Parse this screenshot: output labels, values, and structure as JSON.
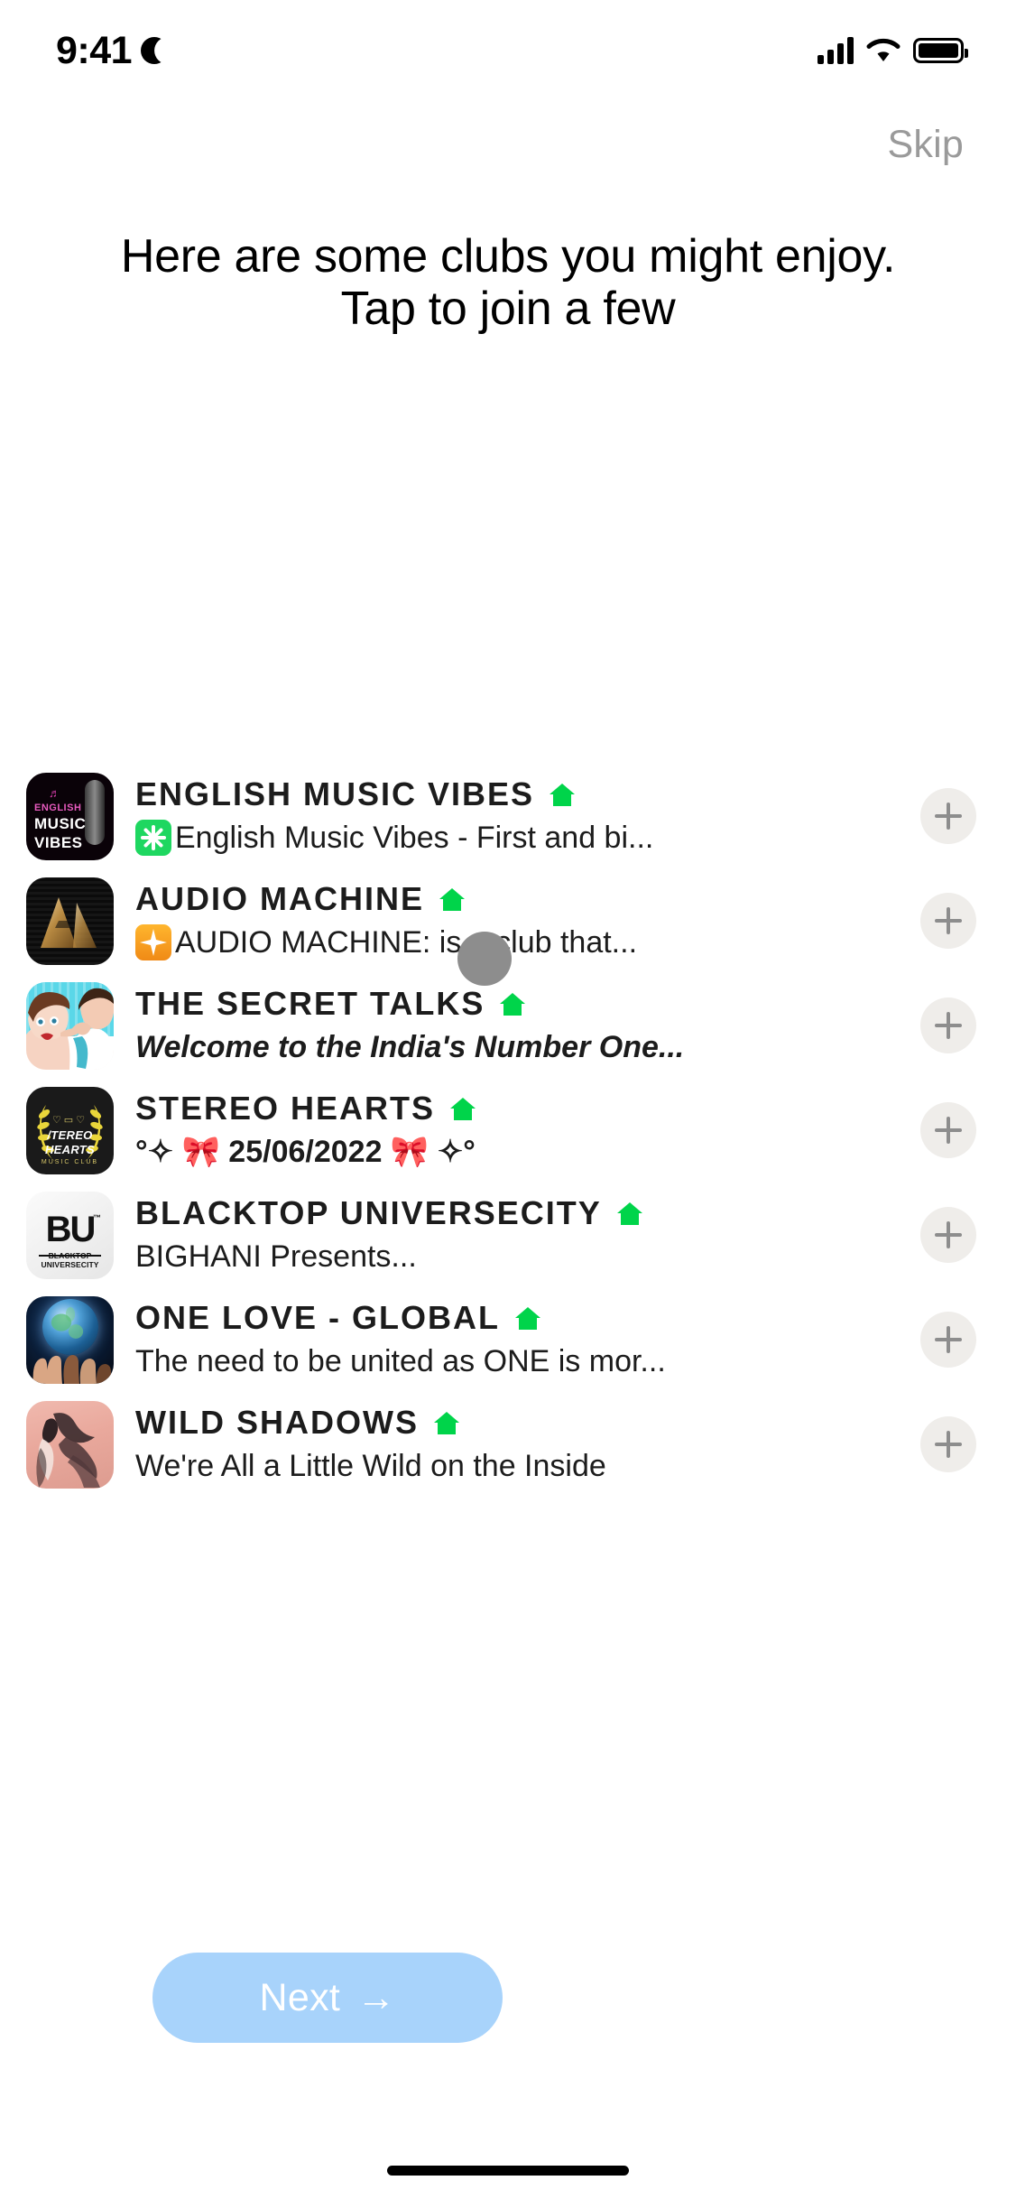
{
  "status_bar": {
    "time": "9:41",
    "dnd_icon": "crescent-moon-icon",
    "signal_icon": "cellular-signal-icon",
    "wifi_icon": "wifi-icon",
    "battery_icon": "battery-full-icon"
  },
  "header": {
    "skip_label": "Skip",
    "title": "Here are some clubs you might enjoy. Tap to join a few"
  },
  "clubs": [
    {
      "name": "ENGLISH MUSIC VIBES",
      "badge_icon": "green-house-icon",
      "sub_emoji": "green-eight-spoked-asterisk-emoji",
      "description": "English Music Vibes - First and bi...",
      "avatar_name": "english-music-vibes-avatar",
      "avatar_lines": [
        "ENGLISH",
        "MUSIC",
        "VIBES"
      ],
      "join_label": "+"
    },
    {
      "name": "AUDIO MACHINE",
      "badge_icon": "green-house-icon",
      "sub_emoji": "orange-eight-pointed-star-emoji",
      "description": "AUDIO MACHINE: is a club that...",
      "avatar_name": "audio-machine-avatar",
      "join_label": "+"
    },
    {
      "name": "THE SECRET TALKS",
      "badge_icon": "green-house-icon",
      "sub_emoji": "",
      "description": "Welcome to the India's Number One...",
      "avatar_name": "the-secret-talks-avatar",
      "join_label": "+"
    },
    {
      "name": "STEREO HEARTS",
      "badge_icon": "green-house-icon",
      "sub_emoji": "",
      "description": "°✧ 🎀 25/06/2022 🎀 ✧°",
      "avatar_name": "stereo-hearts-avatar",
      "avatar_lines": [
        "/TEREO",
        "HEARTS",
        "MUSIC CLUB"
      ],
      "join_label": "+"
    },
    {
      "name": "BLACKTOP UNIVERSECITY",
      "badge_icon": "green-house-icon",
      "sub_emoji": "",
      "description": "BIGHANI Presents...",
      "avatar_name": "blacktop-universecity-avatar",
      "avatar_mark": "BU",
      "avatar_caption": "BLACKTOP UNIVERSECITY",
      "join_label": "+"
    },
    {
      "name": "ONE LOVE - GLOBAL",
      "badge_icon": "green-house-icon",
      "sub_emoji": "",
      "description": "The need to be united as ONE is mor...",
      "avatar_name": "one-love-global-avatar",
      "join_label": "+"
    },
    {
      "name": "WILD SHADOWS",
      "badge_icon": "green-house-icon",
      "sub_emoji": "",
      "description": "We're All a Little Wild on the Inside",
      "avatar_name": "wild-shadows-avatar",
      "join_label": "+"
    }
  ],
  "footer": {
    "next_label": "Next",
    "next_arrow": "→"
  },
  "colors": {
    "accent_button": "#a8d3fb",
    "house_badge": "#00d44a",
    "skip_text": "#9a9a9a",
    "plus_circle": "#efedea",
    "cursor": "#8d8d8d"
  }
}
